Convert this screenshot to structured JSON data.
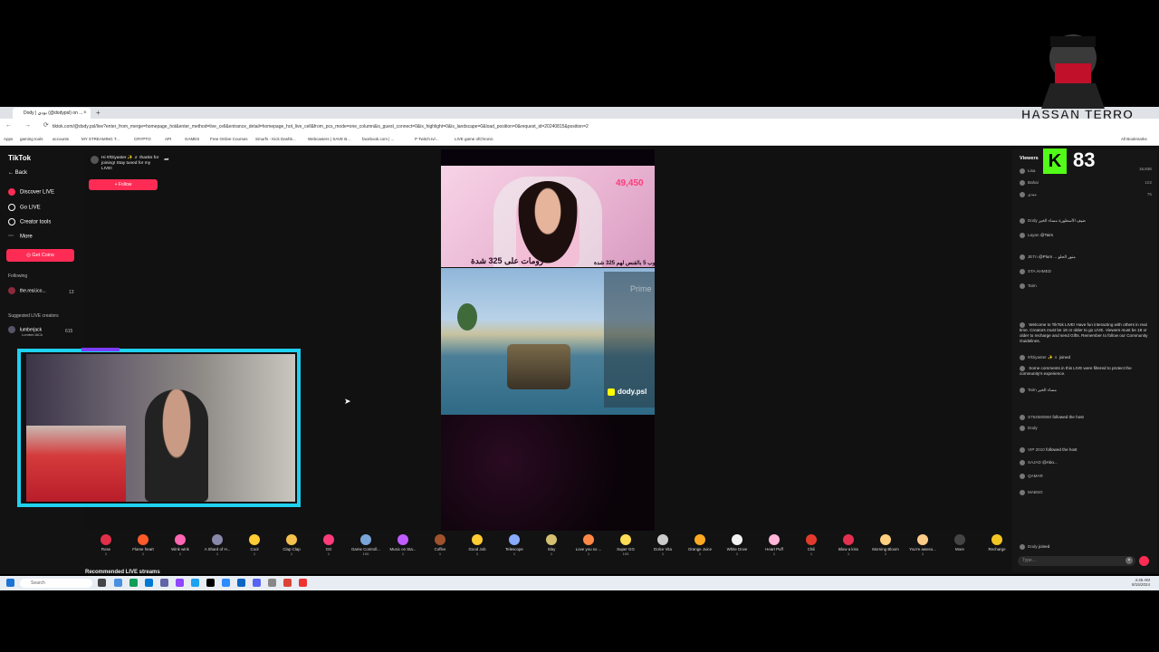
{
  "browser": {
    "tab_title": "Dody | بودي (@dodypsl) on ...",
    "url": "tiktok.com/@dody.psl/live?enter_from_merge=homepage_hot&enter_method=live_cell&entrance_detail=homepage_hot_live_cell&from_pcs_mode=one_column&is_guest_connect=0&is_highlight=0&is_landscape=0&load_position=0&request_id=20240815&position=2",
    "nav_buttons": "← → ⟳",
    "bookmarks": [
      "Apps",
      "gaming tools",
      "accounts",
      "MY STREAMING T...",
      "CRYPTO",
      "API",
      "GAMES",
      "Free Online Courses",
      "Smurfs - Kick Dashb...",
      "Webcasters | SAVE B...",
      "facebook.com | ...",
      "P Twitch.tv/...",
      "LIVE game ofChronic"
    ],
    "all_bookmarks": "All Bookmarks",
    "new_tab": "+",
    "close_tab": "×"
  },
  "sidebar": {
    "logo": "TikTok",
    "back": "Back",
    "items": [
      "Discover LIVE",
      "Go LIVE",
      "Creator tools",
      "More"
    ],
    "get_coins": "Get Coins",
    "following_label": "Following",
    "following_user": "the.real.ico...",
    "following_count": "13",
    "suggested_label": "Suggested LIVE creators",
    "suggested_user": "lumberjack",
    "suggested_sub": "LumberJACk",
    "suggested_count": "615"
  },
  "stream": {
    "follow_message": "Hi #/Diyaster ✨ ♬ thanks for joining! Stay tuned for my LIVE!",
    "follow_button": "+ Follow",
    "coins": "49,450",
    "arabic_left": "رومات على 325 شدة",
    "arabic_right": "توب 5 بالقنص لهم 325 شدة",
    "watermark": "Prime",
    "handle": "dody.psl",
    "recommended": "Recommended LIVE streams"
  },
  "chat": {
    "viewers_label": "Viewers",
    "viewers_count": "16,848",
    "messages": [
      {
        "user": "Lisa",
        "text": "",
        "num": ""
      },
      {
        "user": "Bahai",
        "text": "",
        "num": "102"
      },
      {
        "user": "ميدي",
        "text": "",
        "num": "75"
      },
      {
        "user": "Dody",
        "text": "ضيف الأسطورة مساء الخير",
        "num": ""
      },
      {
        "user": "Layan",
        "text": "@Taim",
        "num": ""
      },
      {
        "user": "JETn",
        "text": "@Plum ... منور الحلو",
        "num": ""
      },
      {
        "user": "STA AHMED",
        "text": "",
        "num": ""
      },
      {
        "user": "Taim",
        "text": "",
        "num": ""
      },
      {
        "user": "",
        "text": "Welcome to TikTok LIVE! Have fun interacting with others in real time. Creators must be 18 or older to go LIVE. Viewers must be 18 or older to recharge and send Gifts. Remember to follow our Community Guidelines.",
        "num": ""
      },
      {
        "user": "#/Diyaster ✨ ♬",
        "text": "joined",
        "num": ""
      },
      {
        "user": "",
        "text": "Some comments in this LIVE were filtered to protect the community's experience.",
        "num": ""
      },
      {
        "user": "Taim",
        "text": "مساء الخير",
        "num": ""
      },
      {
        "user": "S754580560",
        "text": "followed the host",
        "num": ""
      },
      {
        "user": "Dody",
        "text": "",
        "num": ""
      },
      {
        "user": "VIP 2010",
        "text": "followed the host",
        "num": ""
      },
      {
        "user": "SAJAD",
        "text": "@Abo...",
        "num": ""
      },
      {
        "user": "QAMAR",
        "text": "",
        "num": ""
      },
      {
        "user": "MABSO",
        "text": "",
        "num": ""
      },
      {
        "user": "Dody",
        "text": "joined",
        "num": ""
      }
    ],
    "input_placeholder": "Type..."
  },
  "gifts": [
    {
      "name": "Rose",
      "price": "1",
      "color": "#e0304a"
    },
    {
      "name": "Flame heart",
      "price": "1",
      "color": "#ff5a2a"
    },
    {
      "name": "Wink wink",
      "price": "1",
      "color": "#ff66b3"
    },
    {
      "name": "A Shard of H...",
      "price": "1",
      "color": "#8888aa"
    },
    {
      "name": "Cool",
      "price": "1",
      "color": "#ffcc33"
    },
    {
      "name": "Clap Clap",
      "price": "1",
      "color": "#f2c14e"
    },
    {
      "name": "GG",
      "price": "1",
      "color": "#ff3b7a"
    },
    {
      "name": "Game Controll...",
      "price": "100",
      "color": "#7aa5d8"
    },
    {
      "name": "Music on Sta...",
      "price": "1",
      "color": "#c05cff"
    },
    {
      "name": "Coffee",
      "price": "1",
      "color": "#a0522d"
    },
    {
      "name": "Good Job",
      "price": "1",
      "color": "#ffcc33"
    },
    {
      "name": "Telescope",
      "price": "1",
      "color": "#88aaff"
    },
    {
      "name": "Slay",
      "price": "1",
      "color": "#d4c070"
    },
    {
      "name": "Love you so ...",
      "price": "1",
      "color": "#ff8844"
    },
    {
      "name": "Super GG",
      "price": "100",
      "color": "#ffdd55"
    },
    {
      "name": "Dolce Vita",
      "price": "1",
      "color": "#cccccc"
    },
    {
      "name": "Orange Juice",
      "price": "1",
      "color": "#ffaa22"
    },
    {
      "name": "White Dove",
      "price": "1",
      "color": "#f4f4f4"
    },
    {
      "name": "Heart Puff",
      "price": "1",
      "color": "#ffb6d9"
    },
    {
      "name": "Chili",
      "price": "1",
      "color": "#e23b2e"
    },
    {
      "name": "Blow a kiss",
      "price": "1",
      "color": "#e53050"
    },
    {
      "name": "Morning Bloom",
      "price": "1",
      "color": "#ffd080"
    },
    {
      "name": "You're aweso...",
      "price": "1",
      "color": "#ffcc88"
    },
    {
      "name": "More",
      "price": "",
      "color": "#444444"
    },
    {
      "name": "Recharge",
      "price": "",
      "color": "#f3c623"
    }
  ],
  "taskbar": {
    "search_placeholder": "Search",
    "time": "4:45 AM",
    "date": "8/15/2024"
  },
  "overlay": {
    "logo_text": "HASSAN TERRO",
    "kick_count": "83"
  }
}
